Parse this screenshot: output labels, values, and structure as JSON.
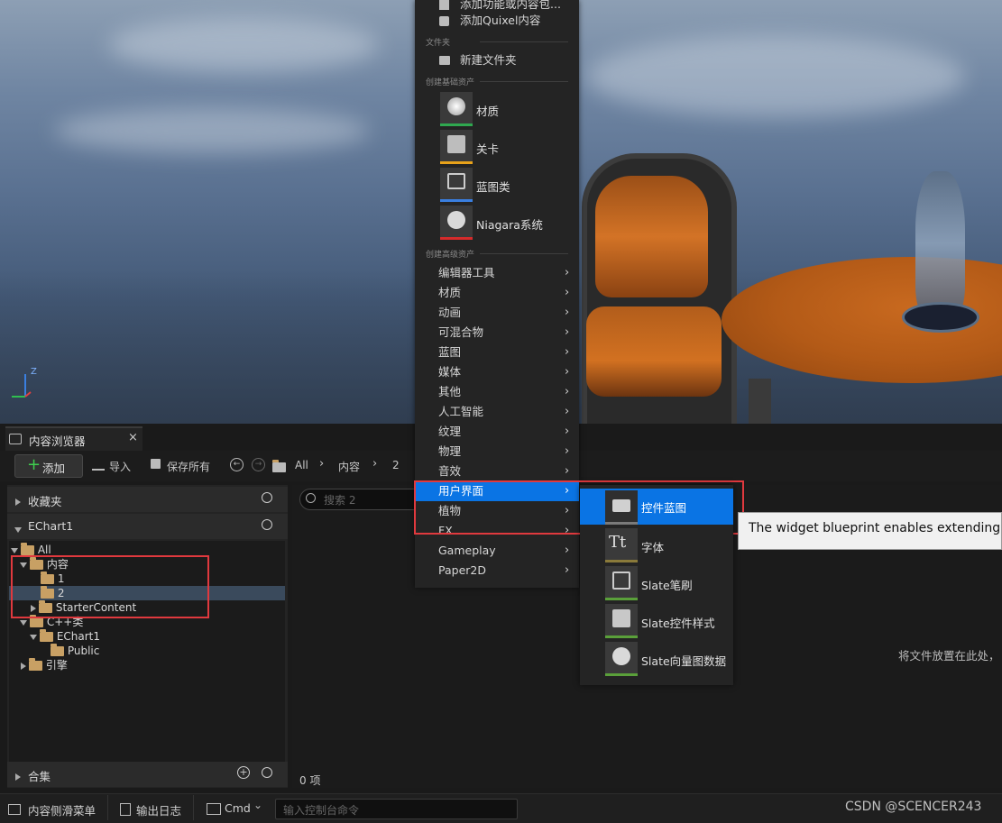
{
  "viewport": {
    "axis_z": "Z"
  },
  "tab": {
    "title": "内容浏览器",
    "close": "×"
  },
  "toolbar": {
    "add_label": "添加",
    "import_label": "导入",
    "save_all_label": "保存所有",
    "breadcrumb": [
      "All",
      "内容",
      "2"
    ]
  },
  "leftpane": {
    "favorites_label": "收藏夹",
    "project_label": "EChart1",
    "collections_label": "合集",
    "tree": [
      {
        "label": "All"
      },
      {
        "label": "内容"
      },
      {
        "label": "1"
      },
      {
        "label": "2"
      },
      {
        "label": "StarterContent"
      },
      {
        "label": "C++类"
      },
      {
        "label": "EChart1"
      },
      {
        "label": "Public"
      },
      {
        "label": "引擎"
      }
    ]
  },
  "rightpane": {
    "search_placeholder": "搜索 2",
    "drop_hint": "将文件放置在此处，",
    "item_count": "0 项"
  },
  "statusbar": {
    "drawer_label": "内容侧滑菜单",
    "log_label": "输出日志",
    "cmd_label": "Cmd",
    "console_placeholder": "输入控制台命令",
    "watermark": "CSDN @SCENCER243"
  },
  "menu": {
    "top_items": [
      "添加功能或内容包...",
      "添加Quixel内容"
    ],
    "section_folder": "文件夹",
    "new_folder": "新建文件夹",
    "section_basic": "创建基础资产",
    "basic_assets": [
      {
        "label": "材质",
        "color": "#2fa84f"
      },
      {
        "label": "关卡",
        "color": "#e8a21a"
      },
      {
        "label": "蓝图类",
        "color": "#3a7fe0"
      },
      {
        "label": "Niagara系统",
        "color": "#d62b2b"
      }
    ],
    "section_advanced": "创建高级资产",
    "advanced_items": [
      "编辑器工具",
      "材质",
      "动画",
      "可混合物",
      "蓝图",
      "媒体",
      "其他",
      "人工智能",
      "纹理",
      "物理",
      "音效",
      "用户界面",
      "植物",
      "FX",
      "Gameplay",
      "Paper2D"
    ]
  },
  "submenu": {
    "items": [
      {
        "label": "控件蓝图",
        "color": "#7a7a7a"
      },
      {
        "label": "字体",
        "color": "#8a7a3a"
      },
      {
        "label": "Slate笔刷",
        "color": "#5aa03a"
      },
      {
        "label": "Slate控件样式",
        "color": "#5aa03a"
      },
      {
        "label": "Slate向量图数据",
        "color": "#5aa03a"
      }
    ]
  },
  "tooltip": {
    "text": "The widget blueprint enables extending U"
  },
  "colors": {
    "highlight": "#0a74e4",
    "annotation": "#e0393e"
  }
}
